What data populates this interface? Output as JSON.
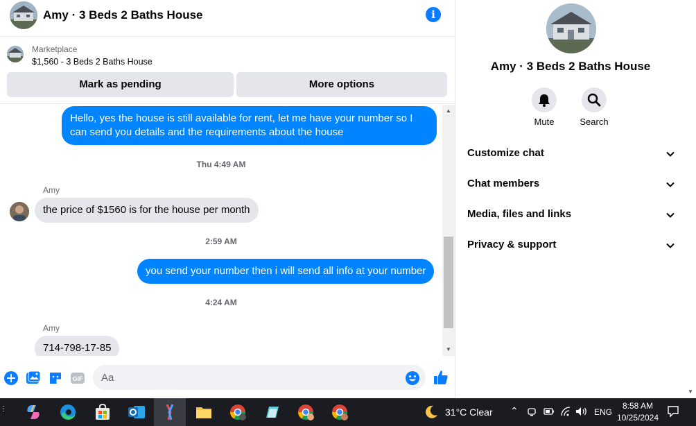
{
  "header": {
    "title": "Amy · 3 Beds 2 Baths House"
  },
  "listing": {
    "source": "Marketplace",
    "description": "$1,560 - 3 Beds 2 Baths House",
    "mark_pending_label": "Mark as pending",
    "more_options_label": "More options"
  },
  "messages": {
    "out1": "Hello, yes the house is still available for rent, let me have your number so I can send you details and the requirements about the house",
    "time1": "Thu 4:49 AM",
    "sender1": "Amy",
    "in1": "the price of $1560 is for the house per month",
    "time2": "2:59 AM",
    "out2": "you send your number then i will send all info at your number",
    "time3": "4:24 AM",
    "sender2": "Amy",
    "in2": "714-798-17-85"
  },
  "composer": {
    "placeholder": "Aa"
  },
  "right_panel": {
    "title": "Amy · 3 Beds 2 Baths House",
    "mute_label": "Mute",
    "search_label": "Search",
    "sections": [
      {
        "label": "Customize chat"
      },
      {
        "label": "Chat members"
      },
      {
        "label": "Media, files and links"
      },
      {
        "label": "Privacy & support"
      }
    ]
  },
  "taskbar": {
    "weather": "31°C  Clear",
    "language": "ENG",
    "time": "8:58 AM",
    "date": "10/25/2024"
  },
  "colors": {
    "accent": "#0084ff",
    "icon_blue": "#0a7cff",
    "bubble_in": "#e4e6eb"
  }
}
